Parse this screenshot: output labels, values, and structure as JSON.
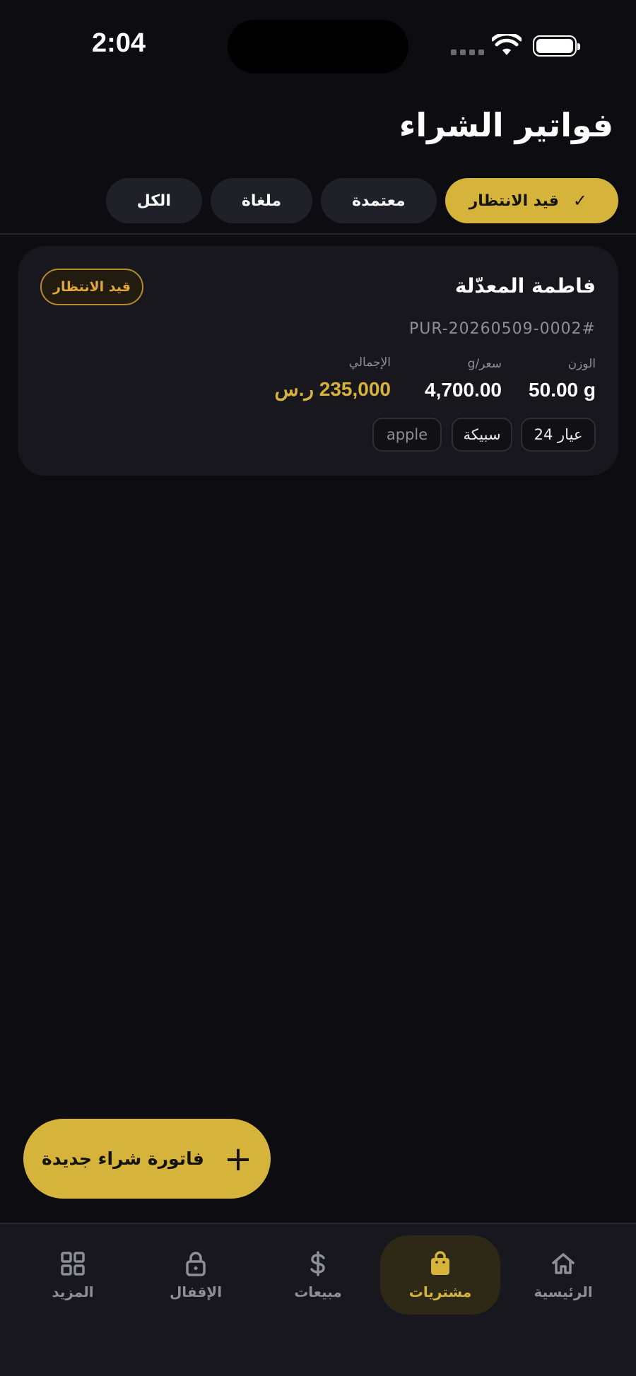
{
  "status_bar": {
    "time": "2:04"
  },
  "header": {
    "title": "فواتير الشراء"
  },
  "filters": [
    {
      "label": "قيد الانتظار",
      "active": true
    },
    {
      "label": "معتمدة",
      "active": false
    },
    {
      "label": "ملغاة",
      "active": false
    },
    {
      "label": "الكل",
      "active": false
    }
  ],
  "invoice": {
    "customer": "فاطمة المعدّلة",
    "status": "قيد الانتظار",
    "number": "PUR-20260509-0002#",
    "weight_label": "الوزن",
    "weight_value": "50.00 g",
    "price_label": "سعر/g",
    "price_value": "4,700.00",
    "total_label": "الإجمالي",
    "total_value": "235,000 ر.س",
    "tags": [
      "عيار 24",
      "سبيكة",
      "apple"
    ]
  },
  "fab": {
    "label": "فاتورة شراء جديدة",
    "icon": "plus-icon"
  },
  "nav": [
    {
      "label": "الرئيسية",
      "icon": "home-icon",
      "active": false
    },
    {
      "label": "مشتريات",
      "icon": "shopping-bag-icon",
      "active": true
    },
    {
      "label": "مبيعات",
      "icon": "dollar-icon",
      "active": false
    },
    {
      "label": "الإقفال",
      "icon": "lock-icon",
      "active": false
    },
    {
      "label": "المزيد",
      "icon": "grid-icon",
      "active": false
    }
  ],
  "colors": {
    "accent": "#d6b43c",
    "background": "#0d0d11",
    "card": "#17171d",
    "pending": "#e1a73a"
  }
}
